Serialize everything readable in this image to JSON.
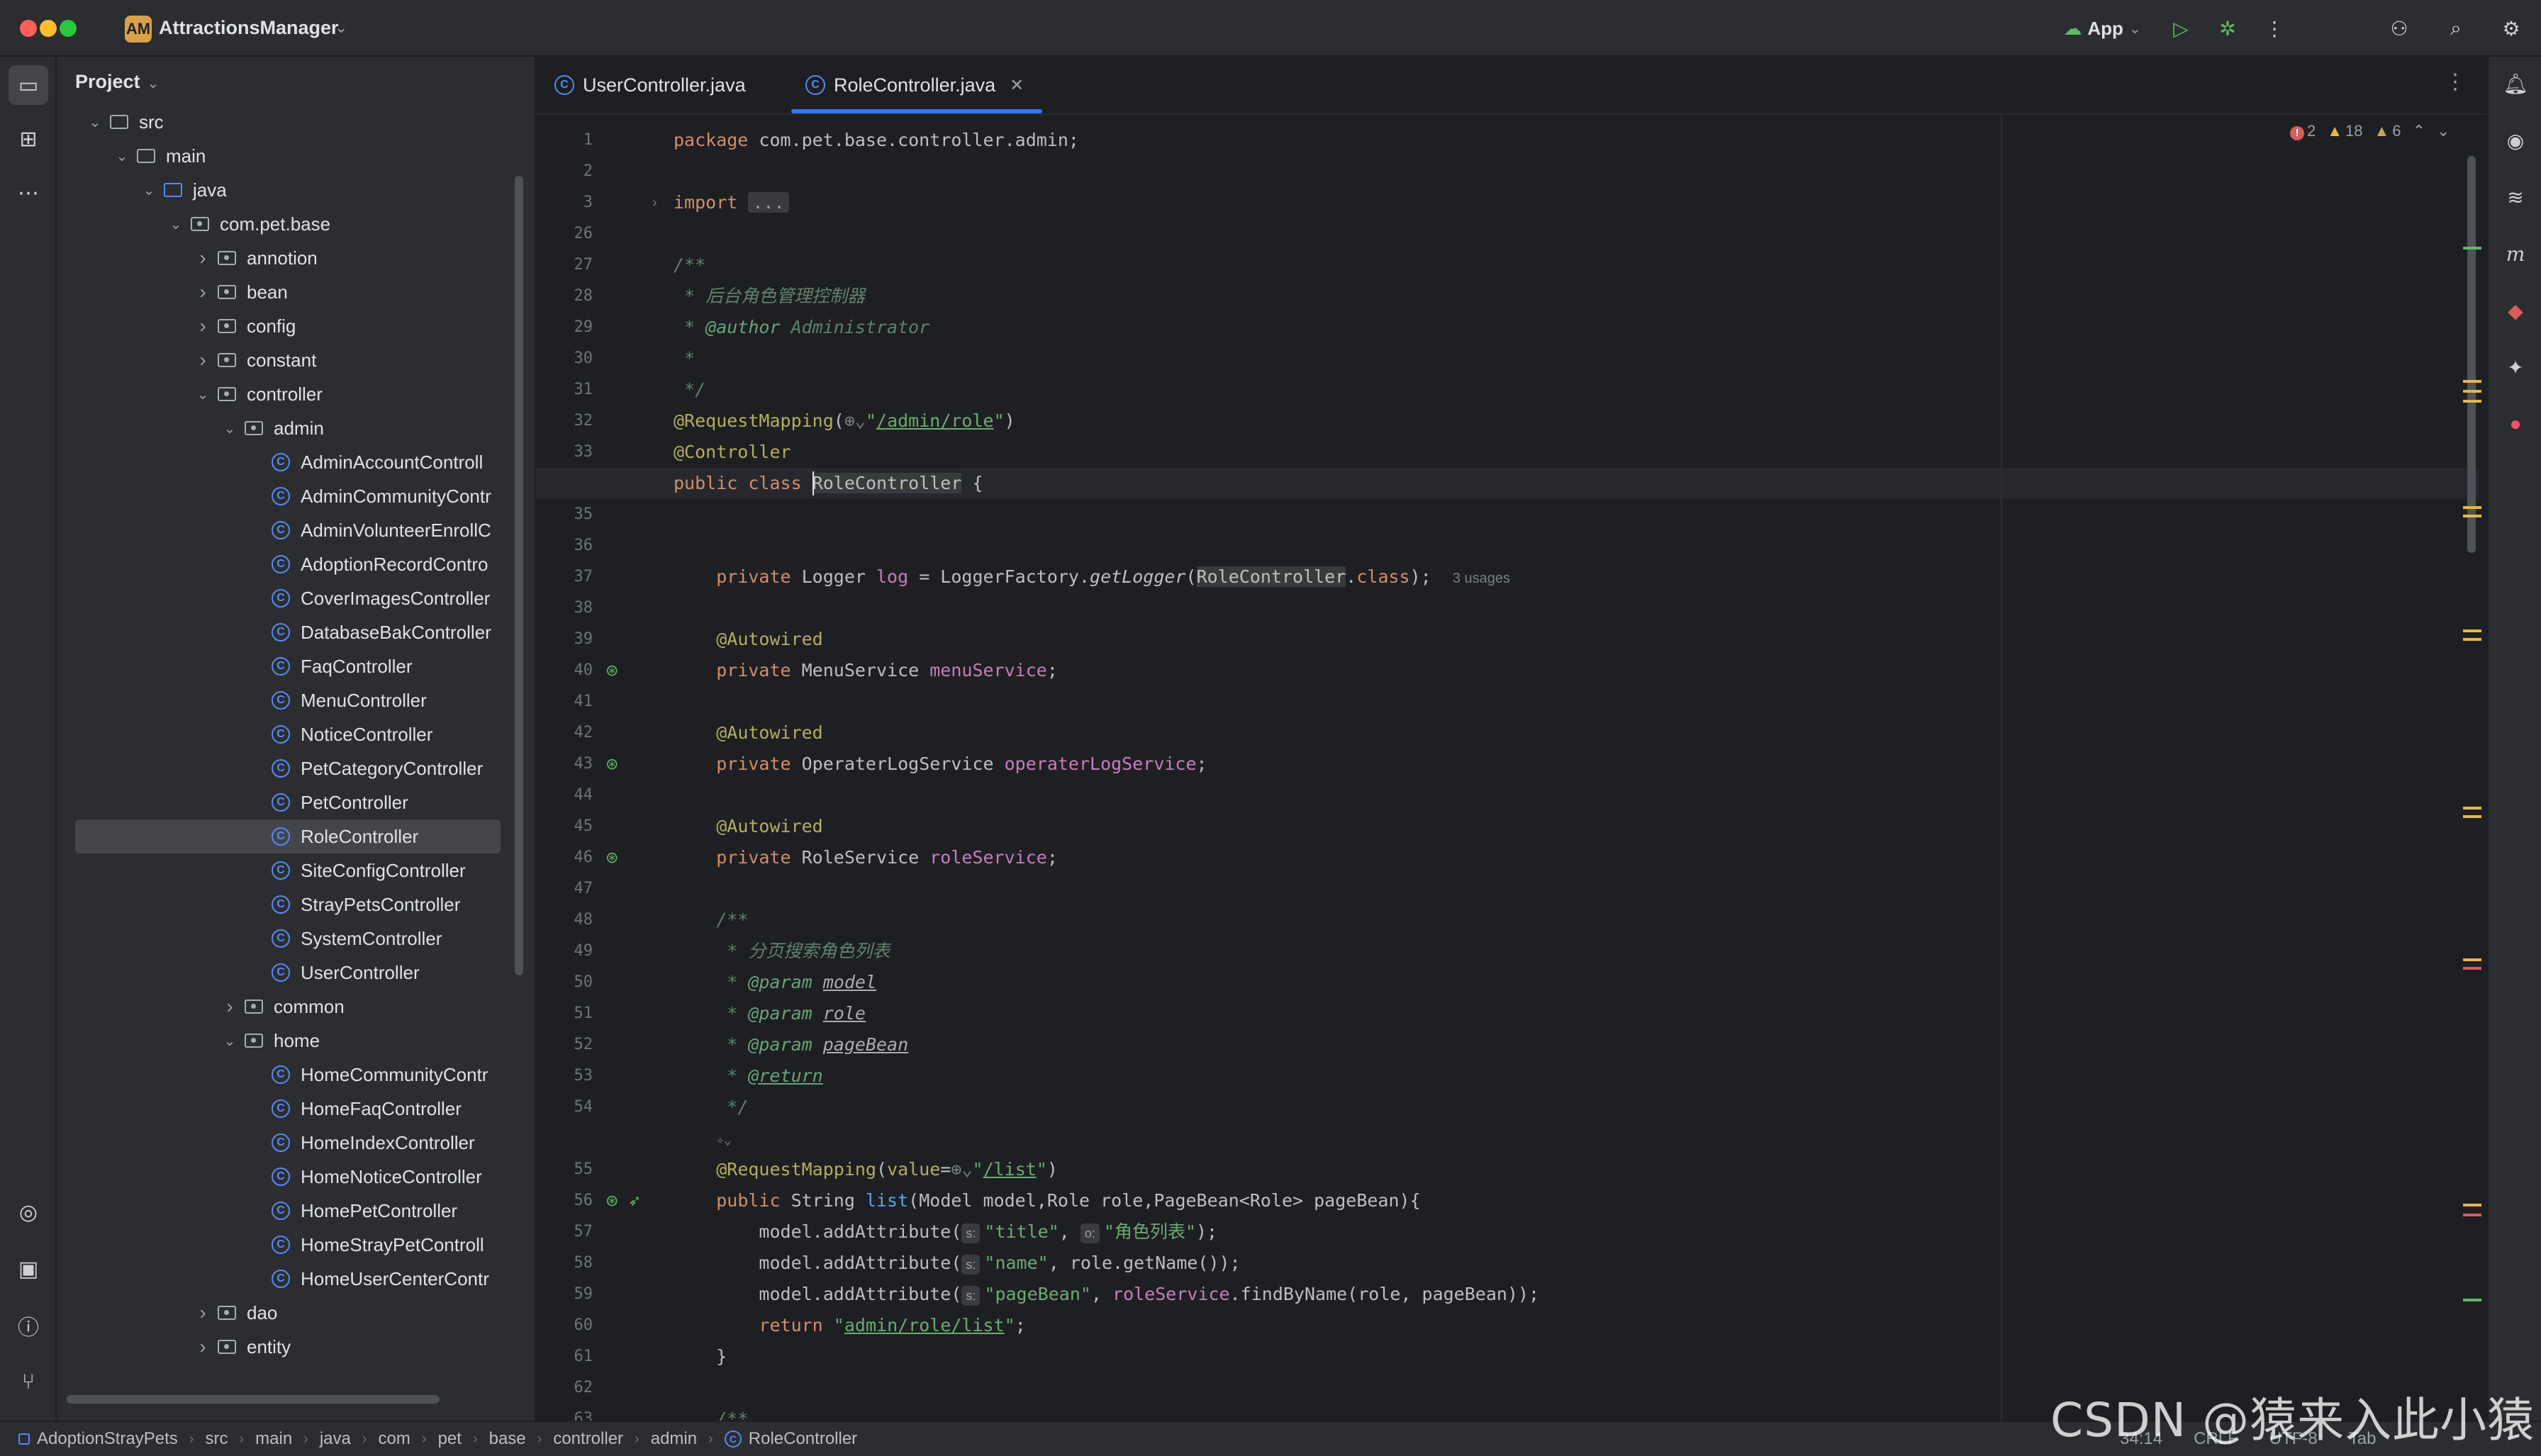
{
  "app": {
    "project_badge": "AM",
    "project_name": "AttractionsManager",
    "run_config": "App"
  },
  "project_panel": {
    "title": "Project",
    "tree": [
      {
        "label": "src",
        "depth": 1,
        "type": "folder",
        "expanded": true
      },
      {
        "label": "main",
        "depth": 2,
        "type": "folder",
        "expanded": true
      },
      {
        "label": "java",
        "depth": 3,
        "type": "source-folder",
        "expanded": true
      },
      {
        "label": "com.pet.base",
        "depth": 4,
        "type": "package",
        "expanded": true
      },
      {
        "label": "annotion",
        "depth": 5,
        "type": "package",
        "expanded": false
      },
      {
        "label": "bean",
        "depth": 5,
        "type": "package",
        "expanded": false
      },
      {
        "label": "config",
        "depth": 5,
        "type": "package",
        "expanded": false
      },
      {
        "label": "constant",
        "depth": 5,
        "type": "package",
        "expanded": false
      },
      {
        "label": "controller",
        "depth": 5,
        "type": "package",
        "expanded": true
      },
      {
        "label": "admin",
        "depth": 6,
        "type": "package",
        "expanded": true
      },
      {
        "label": "AdminAccountControll",
        "depth": 7,
        "type": "class"
      },
      {
        "label": "AdminCommunityContr",
        "depth": 7,
        "type": "class"
      },
      {
        "label": "AdminVolunteerEnrollC",
        "depth": 7,
        "type": "class"
      },
      {
        "label": "AdoptionRecordContro",
        "depth": 7,
        "type": "class"
      },
      {
        "label": "CoverImagesController",
        "depth": 7,
        "type": "class"
      },
      {
        "label": "DatabaseBakController",
        "depth": 7,
        "type": "class"
      },
      {
        "label": "FaqController",
        "depth": 7,
        "type": "class"
      },
      {
        "label": "MenuController",
        "depth": 7,
        "type": "class"
      },
      {
        "label": "NoticeController",
        "depth": 7,
        "type": "class"
      },
      {
        "label": "PetCategoryController",
        "depth": 7,
        "type": "class"
      },
      {
        "label": "PetController",
        "depth": 7,
        "type": "class"
      },
      {
        "label": "RoleController",
        "depth": 7,
        "type": "class",
        "selected": true
      },
      {
        "label": "SiteConfigController",
        "depth": 7,
        "type": "class"
      },
      {
        "label": "StrayPetsController",
        "depth": 7,
        "type": "class"
      },
      {
        "label": "SystemController",
        "depth": 7,
        "type": "class"
      },
      {
        "label": "UserController",
        "depth": 7,
        "type": "class"
      },
      {
        "label": "common",
        "depth": 6,
        "type": "package",
        "expanded": false
      },
      {
        "label": "home",
        "depth": 6,
        "type": "package",
        "expanded": true
      },
      {
        "label": "HomeCommunityContr",
        "depth": 7,
        "type": "class"
      },
      {
        "label": "HomeFaqController",
        "depth": 7,
        "type": "class"
      },
      {
        "label": "HomeIndexController",
        "depth": 7,
        "type": "class"
      },
      {
        "label": "HomeNoticeController",
        "depth": 7,
        "type": "class"
      },
      {
        "label": "HomePetController",
        "depth": 7,
        "type": "class"
      },
      {
        "label": "HomeStrayPetControll",
        "depth": 7,
        "type": "class"
      },
      {
        "label": "HomeUserCenterContr",
        "depth": 7,
        "type": "class"
      },
      {
        "label": "dao",
        "depth": 5,
        "type": "package",
        "expanded": false
      },
      {
        "label": "entity",
        "depth": 5,
        "type": "package",
        "expanded": false
      }
    ]
  },
  "tabs": [
    {
      "label": "UserController.java",
      "active": false
    },
    {
      "label": "RoleController.java",
      "active": true
    }
  ],
  "inspections": {
    "errors": "2",
    "warnings": "18",
    "weak_warnings": "6"
  },
  "editor": {
    "current_line": "34",
    "lines": [
      {
        "n": "1",
        "html": "<span class='kw'>package</span> com.pet.base.controller.admin;"
      },
      {
        "n": "2",
        "html": ""
      },
      {
        "n": "3",
        "html": "<span class='kw'>import</span> <span class='folded'>...</span>",
        "fold": true
      },
      {
        "n": "26",
        "html": ""
      },
      {
        "n": "27",
        "html": "<span class='doc'>/**</span>"
      },
      {
        "n": "28",
        "html": "<span class='doc'> * 后台角色管理控制器</span>"
      },
      {
        "n": "29",
        "html": "<span class='doc'> * </span><span class='doctag'>@author</span><span class='doc'> Administrator</span>"
      },
      {
        "n": "30",
        "html": "<span class='doc'> *</span>"
      },
      {
        "n": "31",
        "html": "<span class='doc'> */</span>"
      },
      {
        "n": "32",
        "html": "<span class='ann'>@RequestMapping</span>(<span class='cmt'>⊕⌄</span><span class='str'>\"<span class='link'>/admin/role</span>\"</span>)"
      },
      {
        "n": "33",
        "html": "<span class='ann'>@Controller</span>"
      },
      {
        "n": "34",
        "html": "<span class='kw'>public class</span> <span class='hl-usage'>RoleController</span> {",
        "gutter": "bean"
      },
      {
        "n": "35",
        "html": ""
      },
      {
        "n": "36",
        "html": ""
      },
      {
        "n": "37",
        "html": "    <span class='kw'>private</span> Logger <span class='fld'>log</span> = LoggerFactory.<span class='itf'>getLogger</span>(<span class='hl-usage'>RoleController</span>.<span class='kw'>class</span>);  <span class='hint'>3 usages</span>"
      },
      {
        "n": "38",
        "html": ""
      },
      {
        "n": "39",
        "html": "    <span class='ann'>@Autowired</span>"
      },
      {
        "n": "40",
        "html": "    <span class='kw'>private</span> MenuService <span class='fld'>menuService</span>;",
        "gutter": "bean"
      },
      {
        "n": "41",
        "html": ""
      },
      {
        "n": "42",
        "html": "    <span class='ann'>@Autowired</span>"
      },
      {
        "n": "43",
        "html": "    <span class='kw'>private</span> OperaterLogService <span class='fld'>operaterLogService</span>;",
        "gutter": "bean"
      },
      {
        "n": "44",
        "html": ""
      },
      {
        "n": "45",
        "html": "    <span class='ann'>@Autowired</span>"
      },
      {
        "n": "46",
        "html": "    <span class='kw'>private</span> RoleService <span class='fld'>roleService</span>;",
        "gutter": "bean"
      },
      {
        "n": "47",
        "html": ""
      },
      {
        "n": "48",
        "html": "    <span class='doc'>/**</span>"
      },
      {
        "n": "49",
        "html": "    <span class='doc'> * 分页搜索角色列表</span>"
      },
      {
        "n": "50",
        "html": "    <span class='doc'> * </span><span class='doctag'>@param</span> <span class='docparam'>model</span>"
      },
      {
        "n": "51",
        "html": "    <span class='doc'> * </span><span class='doctag'>@param</span> <span class='docparam'>role</span>"
      },
      {
        "n": "52",
        "html": "    <span class='doc'> * </span><span class='doctag'>@param</span> <span class='docparam'>pageBean</span>"
      },
      {
        "n": "53",
        "html": "    <span class='doc'> * </span><span class='doctag' style='text-decoration:underline'>@return</span>"
      },
      {
        "n": "54",
        "html": "    <span class='doc'> */</span>"
      },
      {
        "n": "",
        "html": "    <span class='cmt' style='font-size:18px'>✧⌄</span>"
      },
      {
        "n": "55",
        "html": "    <span class='ann'>@RequestMapping</span>(<span class='ann'>value</span>=<span class='cmt'>⊕⌄</span><span class='str'>\"<span class='link'>/list</span>\"</span>)"
      },
      {
        "n": "56",
        "html": "    <span class='kw'>public</span> String <span class='fn'>list</span>(Model model,Role role,PageBean&lt;Role&gt; pageBean){",
        "gutter": "bean-route"
      },
      {
        "n": "57",
        "html": "        model.addAttribute(<span class='param-hint'>s:</span><span class='str'>\"title\"</span>, <span class='param-hint'>o:</span><span class='str'>\"角色列表\"</span>);"
      },
      {
        "n": "58",
        "html": "        model.addAttribute(<span class='param-hint'>s:</span><span class='str'>\"name\"</span>, role.getName());"
      },
      {
        "n": "59",
        "html": "        model.addAttribute(<span class='param-hint'>s:</span><span class='str'>\"pageBean\"</span>, <span class='fld'>roleService</span>.findByName(role, pageBean));"
      },
      {
        "n": "60",
        "html": "        <span class='kw'>return</span> <span class='str'>\"<span class='link'>admin/role/list</span>\"</span>;"
      },
      {
        "n": "61",
        "html": "    }"
      },
      {
        "n": "62",
        "html": ""
      },
      {
        "n": "63",
        "html": "    <span class='doc'>/**</span>"
      }
    ]
  },
  "breadcrumb": [
    "AdoptionStrayPets",
    "src",
    "main",
    "java",
    "com",
    "pet",
    "base",
    "controller",
    "admin",
    "RoleController"
  ],
  "status": {
    "position": "34:14",
    "line_sep": "CRLF",
    "encoding": "UTF-8",
    "indent": "Tab"
  },
  "watermark": "CSDN @猿来入此小猿"
}
